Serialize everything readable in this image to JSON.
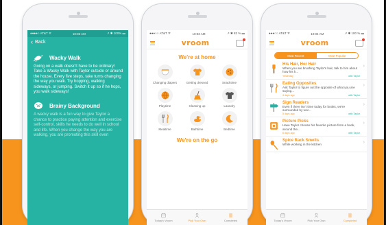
{
  "colors": {
    "orange": "#f7941d",
    "teal": "#26b3a4",
    "band": "#f7941d"
  },
  "phone1": {
    "status": {
      "carrier": "●●●●○ AT&T ᯤ",
      "time": "10:03 AM",
      "battery": "↗ ✱ 100% ▬"
    },
    "back_label": "Back",
    "activity": {
      "title": "Wacky Walk",
      "body": "Going on a walk doesn't have to be ordinary! Take a Wacky Walk with Taylor outside or around the house. Every five steps, take turns changing the way you walk. Try hopping, walking sideways, or jumping. Switch it up so if he hops, you walk sideways!"
    },
    "background": {
      "title": "Brainy Background",
      "body": "A wacky walk is a fun way to give Taylor a chance to practice paying attention and exercise self-control, skills he needs to do well in school and life. When you change the way you are walking, you are promoting this skill even"
    }
  },
  "phone2": {
    "status": {
      "carrier": "●●●○○ AT&T ᯤ",
      "time": "10:03 AM",
      "battery": "↗ ✱ 83 % ▬"
    },
    "logo": "vroom",
    "home_title": "We're at home",
    "grid": [
      {
        "label": "Changing diapers",
        "icon": "diaper-icon"
      },
      {
        "label": "Getting dressed",
        "icon": "shirt-icon"
      },
      {
        "label": "Snacktime",
        "icon": "cookie-icon"
      },
      {
        "label": "Playtime",
        "icon": "ball-icon"
      },
      {
        "label": "Cleaning up",
        "icon": "broom-icon"
      },
      {
        "label": "Laundry",
        "icon": "tshirt-icon"
      },
      {
        "label": "Mealtime",
        "icon": "utensils-icon"
      },
      {
        "label": "Bathtime",
        "icon": "duck-icon"
      },
      {
        "label": "Bedtime",
        "icon": "moon-icon"
      }
    ],
    "go_title": "We're on the go",
    "tabs": [
      {
        "label": "Today's Vroom",
        "icon": "calendar-icon"
      },
      {
        "label": "Pick Your Own",
        "icon": "person-icon"
      },
      {
        "label": "Completed",
        "icon": "list-icon"
      }
    ]
  },
  "phone3": {
    "status": {
      "carrier": "●●●○○ AT&T ᯤ",
      "time": "10:04 AM",
      "battery": "↗ ✱ 100 % ▬"
    },
    "logo": "vroom",
    "segments": [
      "Most Recent",
      "Most Popular"
    ],
    "items": [
      {
        "title": "His Hair, Her Hair",
        "desc": "When you are brushing Taylor's hair, talk to him about how his h...",
        "day": "Yesterday",
        "tag": "with Taylor",
        "icon": "brush-icon"
      },
      {
        "title": "Eating Opposites",
        "desc": "Ask Taylor to figure out the opposite of what you are saying...",
        "day": "4 days ago",
        "tag": "with Taylor",
        "icon": "utensils-icon"
      },
      {
        "title": "Sign Readers",
        "desc": "Even if there isn't time today for books, we're surrounded by wor...",
        "day": "5 days ago",
        "tag": "with Taylor",
        "icon": "sign-icon"
      },
      {
        "title": "Picture Picks",
        "desc": "Have Taylor choose his favorite picture from a book, around the...",
        "day": "6 days ago",
        "tag": "with Taylor",
        "icon": "frame-icon"
      },
      {
        "title": "Spice Rack Smells",
        "desc": "While working in the kitchen",
        "day": "",
        "tag": "",
        "icon": "spoon-icon"
      }
    ],
    "tabs": [
      {
        "label": "Today's Vroom",
        "icon": "calendar-icon"
      },
      {
        "label": "Pick Your Own",
        "icon": "person-icon"
      },
      {
        "label": "Completed",
        "icon": "list-icon"
      }
    ]
  }
}
